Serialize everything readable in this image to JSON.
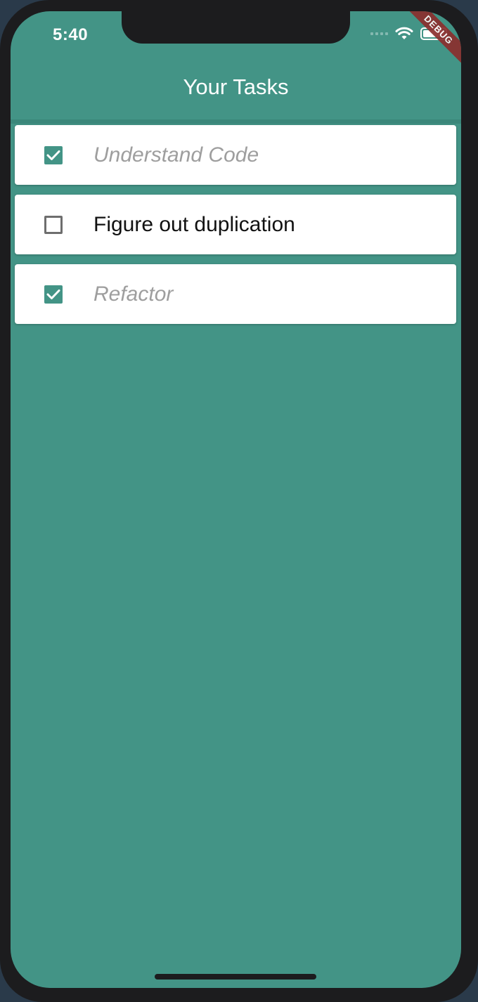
{
  "status_bar": {
    "time": "5:40"
  },
  "debug_banner": "DEBUG",
  "app_bar": {
    "title": "Your Tasks"
  },
  "tasks": [
    {
      "label": "Understand Code",
      "done": true
    },
    {
      "label": "Figure out duplication",
      "done": false
    },
    {
      "label": "Refactor",
      "done": true
    }
  ],
  "colors": {
    "primary": "#439486",
    "card": "#ffffff",
    "done_text": "#9e9e9e",
    "debug_ribbon": "#8b2e2e"
  },
  "icons": {
    "checked": "check-icon",
    "wifi": "wifi-icon",
    "battery": "battery-icon",
    "signal": "signal-icon"
  }
}
